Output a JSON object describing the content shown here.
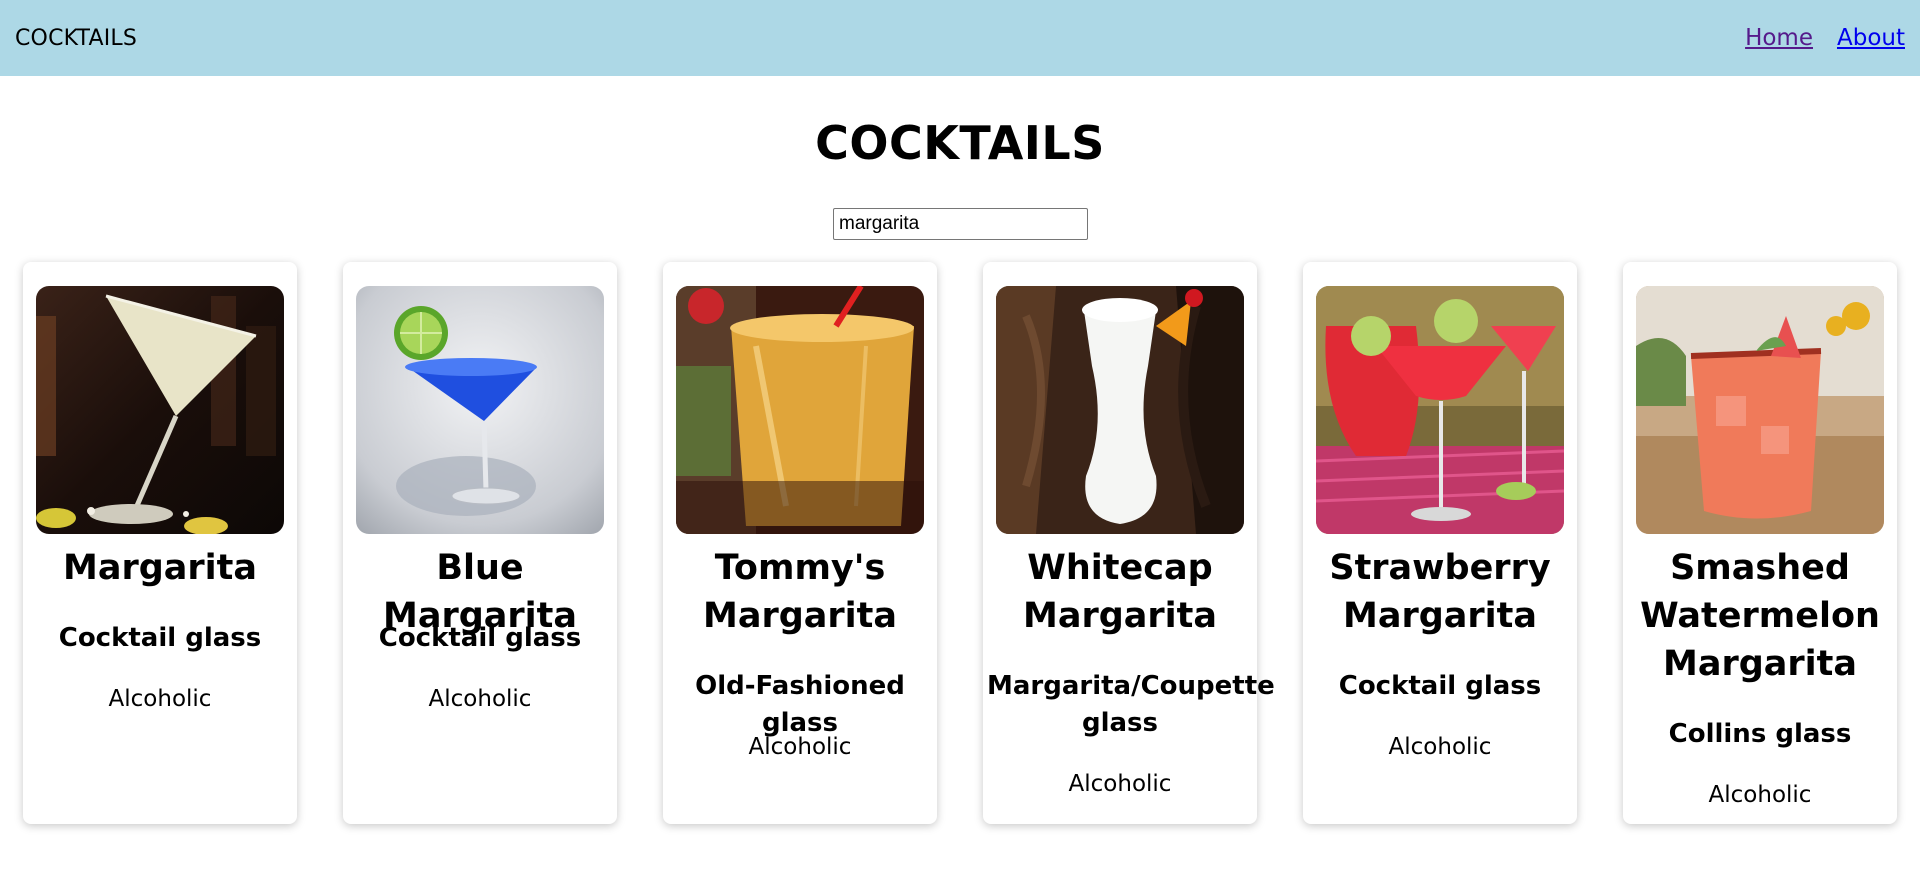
{
  "header": {
    "brand": "COCKTAILS",
    "nav": [
      {
        "label": "Home"
      },
      {
        "label": "About"
      }
    ]
  },
  "main": {
    "title": "COCKTAILS",
    "search": {
      "value": "margarita",
      "placeholder": ""
    }
  },
  "cocktails": [
    {
      "name": "Margarita",
      "glass": "Cocktail glass",
      "type": "Alcoholic",
      "image_icon": "martini-glass-photo"
    },
    {
      "name": "Blue Margarita",
      "glass": "Cocktail glass",
      "type": "Alcoholic",
      "image_icon": "blue-martini-photo"
    },
    {
      "name": "Tommy's Margarita",
      "glass": "Old-Fashioned glass",
      "type": "Alcoholic",
      "image_icon": "tumbler-drink-photo"
    },
    {
      "name": "Whitecap Margarita",
      "glass": "Margarita/Coupette glass",
      "type": "Alcoholic",
      "image_icon": "white-hurricane-glass-photo"
    },
    {
      "name": "Strawberry Margarita",
      "glass": "Cocktail glass",
      "type": "Alcoholic",
      "image_icon": "strawberry-margarita-photo"
    },
    {
      "name": "Smashed Watermelon Margarita",
      "glass": "Collins glass",
      "type": "Alcoholic",
      "image_icon": "watermelon-drink-photo"
    }
  ],
  "colors": {
    "navbar_bg": "#add8e6",
    "link_visited": "#551a8b",
    "link": "#0000ee"
  }
}
